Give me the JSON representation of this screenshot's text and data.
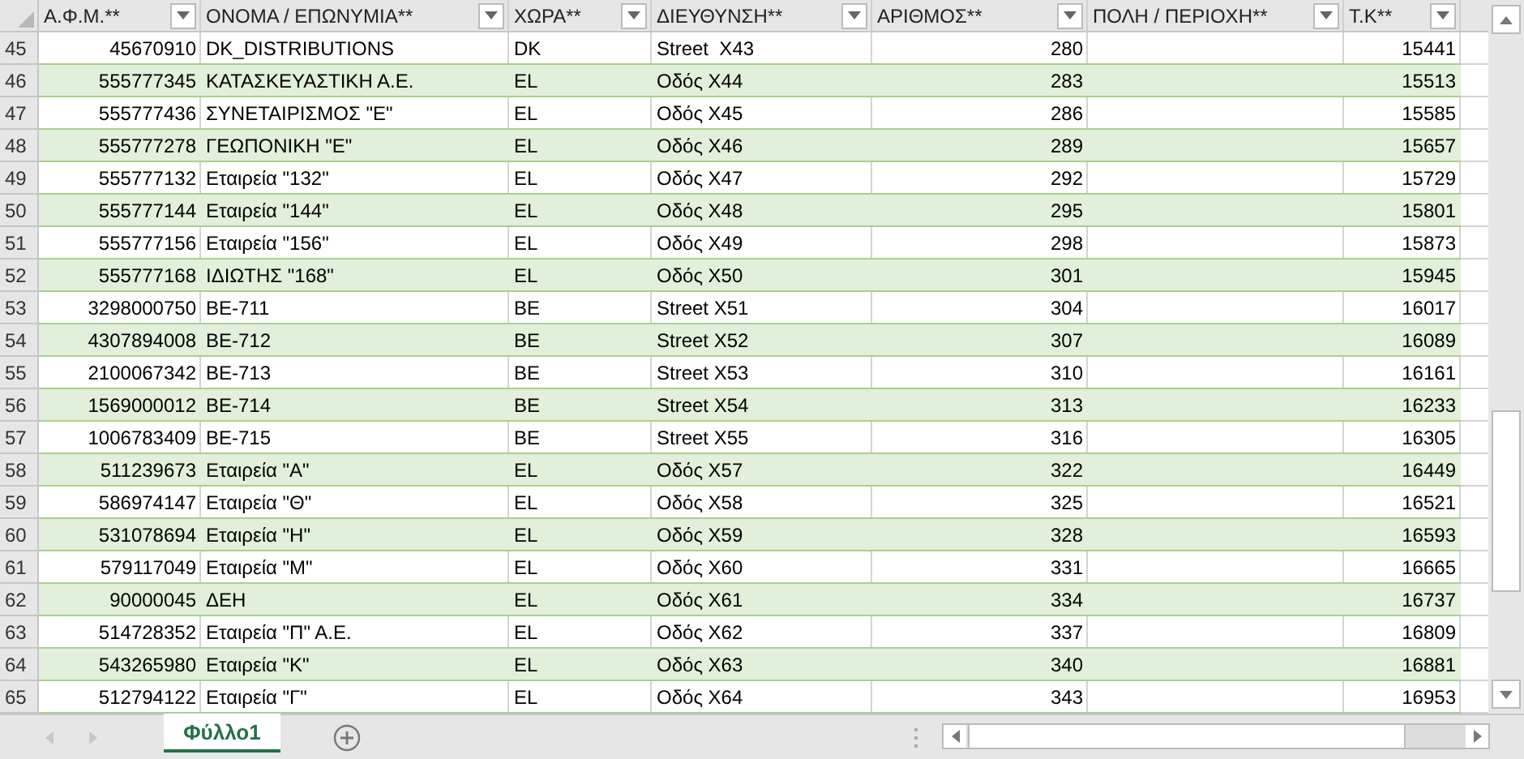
{
  "columns": [
    {
      "label": "Α.Φ.Μ.**",
      "kind": "number"
    },
    {
      "label": "ΟΝΟΜΑ / ΕΠΩΝΥΜΙΑ**",
      "kind": "text"
    },
    {
      "label": "ΧΩΡΑ**",
      "kind": "text"
    },
    {
      "label": "ΔΙΕΥΘΥΝΣΗ**",
      "kind": "text"
    },
    {
      "label": "ΑΡΙΘΜΟΣ**",
      "kind": "number"
    },
    {
      "label": "ΠΟΛΗ / ΠΕΡΙΟΧΗ**",
      "kind": "text"
    },
    {
      "label": "Τ.Κ**",
      "kind": "number"
    }
  ],
  "rows": [
    {
      "number": "45",
      "shaded": false,
      "cells": [
        "45670910",
        "DK_DISTRIBUTIONS",
        "DK",
        "Street  X43",
        "280",
        "",
        "15441"
      ]
    },
    {
      "number": "46",
      "shaded": true,
      "cells": [
        "555777345",
        "ΚΑΤΑΣΚΕΥΑΣΤΙΚΗ Α.Ε.",
        "EL",
        "Οδός Χ44",
        "283",
        "",
        "15513"
      ]
    },
    {
      "number": "47",
      "shaded": false,
      "cells": [
        "555777436",
        "ΣΥΝΕΤΑΙΡΙΣΜΟΣ \"Ε\"",
        "EL",
        "Οδός Χ45",
        "286",
        "",
        "15585"
      ]
    },
    {
      "number": "48",
      "shaded": true,
      "cells": [
        "555777278",
        "ΓΕΩΠΟΝΙΚΗ \"Ε\"",
        "EL",
        "Οδός Χ46",
        "289",
        "",
        "15657"
      ]
    },
    {
      "number": "49",
      "shaded": false,
      "cells": [
        "555777132",
        "Εταιρεία \"132\"",
        "EL",
        "Οδός Χ47",
        "292",
        "",
        "15729"
      ]
    },
    {
      "number": "50",
      "shaded": true,
      "cells": [
        "555777144",
        "Εταιρεία \"144\"",
        "EL",
        "Οδός Χ48",
        "295",
        "",
        "15801"
      ]
    },
    {
      "number": "51",
      "shaded": false,
      "cells": [
        "555777156",
        "Εταιρεία \"156\"",
        "EL",
        "Οδός Χ49",
        "298",
        "",
        "15873"
      ]
    },
    {
      "number": "52",
      "shaded": true,
      "cells": [
        "555777168",
        "ΙΔΙΩΤΗΣ \"168\"",
        "EL",
        "Οδός Χ50",
        "301",
        "",
        "15945"
      ]
    },
    {
      "number": "53",
      "shaded": false,
      "cells": [
        "3298000750",
        "BE-711",
        "BE",
        "Street X51",
        "304",
        "",
        "16017"
      ]
    },
    {
      "number": "54",
      "shaded": true,
      "cells": [
        "4307894008",
        "BE-712",
        "BE",
        "Street X52",
        "307",
        "",
        "16089"
      ]
    },
    {
      "number": "55",
      "shaded": false,
      "cells": [
        "2100067342",
        "BE-713",
        "BE",
        "Street X53",
        "310",
        "",
        "16161"
      ]
    },
    {
      "number": "56",
      "shaded": true,
      "cells": [
        "1569000012",
        "BE-714",
        "BE",
        "Street X54",
        "313",
        "",
        "16233"
      ]
    },
    {
      "number": "57",
      "shaded": false,
      "cells": [
        "1006783409",
        "BE-715",
        "BE",
        "Street X55",
        "316",
        "",
        "16305"
      ]
    },
    {
      "number": "58",
      "shaded": true,
      "cells": [
        "511239673",
        "Εταιρεία \"Α\"",
        "EL",
        "Οδός Χ57",
        "322",
        "",
        "16449"
      ]
    },
    {
      "number": "59",
      "shaded": false,
      "cells": [
        "586974147",
        "Εταιρεία \"Θ\"",
        "EL",
        "Οδός Χ58",
        "325",
        "",
        "16521"
      ]
    },
    {
      "number": "60",
      "shaded": true,
      "cells": [
        "531078694",
        "Εταιρεία \"Η\"",
        "EL",
        "Οδός Χ59",
        "328",
        "",
        "16593"
      ]
    },
    {
      "number": "61",
      "shaded": false,
      "cells": [
        "579117049",
        "Εταιρεία \"Μ\"",
        "EL",
        "Οδός Χ60",
        "331",
        "",
        "16665"
      ]
    },
    {
      "number": "62",
      "shaded": true,
      "cells": [
        "90000045",
        "ΔΕΗ",
        "EL",
        "Οδός Χ61",
        "334",
        "",
        "16737"
      ]
    },
    {
      "number": "63",
      "shaded": false,
      "cells": [
        "514728352",
        "Εταιρεία \"Π\" Α.Ε.",
        "EL",
        "Οδός Χ62",
        "337",
        "",
        "16809"
      ]
    },
    {
      "number": "64",
      "shaded": true,
      "cells": [
        "543265980",
        "Εταιρεία \"Κ\"",
        "EL",
        "Οδός Χ63",
        "340",
        "",
        "16881"
      ]
    },
    {
      "number": "65",
      "shaded": false,
      "cells": [
        "512794122",
        "Εταιρεία \"Γ\"",
        "EL",
        "Οδός Χ64",
        "343",
        "",
        "16953"
      ]
    }
  ],
  "sheet_tabs": [
    {
      "label": "Φύλλο1",
      "selected": true
    }
  ]
}
